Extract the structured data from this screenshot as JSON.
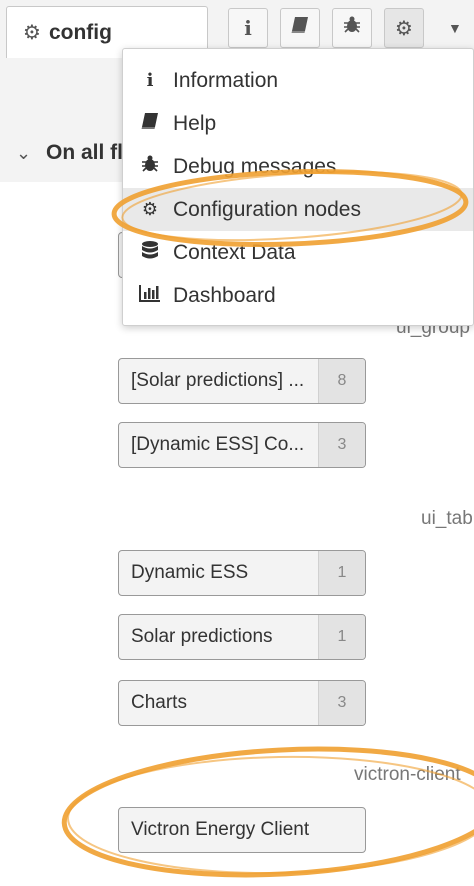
{
  "tabbar": {
    "active_tab_label": "config",
    "active_tab_icon": "gear-icon",
    "buttons": [
      {
        "name": "info",
        "icon": "info-icon",
        "glyph": "i"
      },
      {
        "name": "help",
        "icon": "book-icon",
        "glyph": "📘"
      },
      {
        "name": "debug",
        "icon": "bug-icon",
        "glyph": "🐞"
      },
      {
        "name": "config",
        "icon": "gear-icon",
        "glyph": "⚙"
      }
    ],
    "dropdown_caret": "▼"
  },
  "section": {
    "chevron": "⌄",
    "title": "On all fl"
  },
  "groups": {
    "ui_group_label": "ui_group",
    "ui_tab_label": "ui_tab",
    "victron_label": "victron-client"
  },
  "nodes": [
    {
      "label": "[Solar predictions] ...",
      "count": "8"
    },
    {
      "label": "[Dynamic ESS] Co...",
      "count": "3"
    },
    {
      "label": "Dynamic ESS",
      "count": "1"
    },
    {
      "label": "Solar predictions",
      "count": "1"
    },
    {
      "label": "Charts",
      "count": "3"
    },
    {
      "label": "Victron Energy Client",
      "count": ""
    }
  ],
  "menu": {
    "items": [
      {
        "label": "Information",
        "icon": "info-icon",
        "glyph": "i"
      },
      {
        "label": "Help",
        "icon": "book-icon",
        "glyph": "▰"
      },
      {
        "label": "Debug messages",
        "icon": "bug-icon",
        "glyph": "✱"
      },
      {
        "label": "Configuration nodes",
        "icon": "gear-icon",
        "glyph": "⚙"
      },
      {
        "label": "Context Data",
        "icon": "database-icon",
        "glyph": "☰"
      },
      {
        "label": "Dashboard",
        "icon": "chart-icon",
        "glyph": "▥"
      }
    ]
  },
  "colors": {
    "annotation": "#f0a030",
    "highlight": "#e9e9e9"
  }
}
